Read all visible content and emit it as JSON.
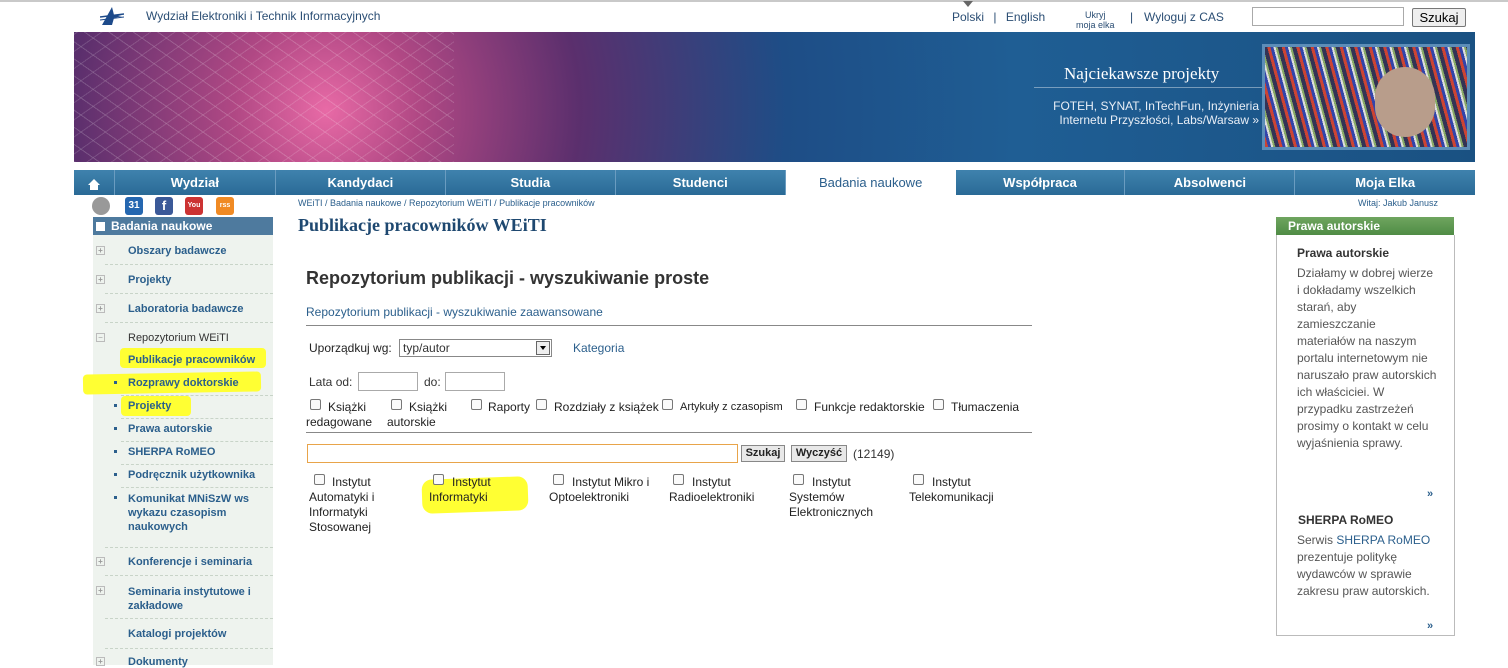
{
  "header": {
    "faculty_name": "Wydział Elektroniki i Technik Informacyjnych",
    "lang_polish": "Polski",
    "lang_sep": "|",
    "lang_english": "English",
    "hide_line1": "Ukryj",
    "hide_line2": "moja elka",
    "logout_sep": "|",
    "logout": "Wyloguj z CAS",
    "search_button": "Szukaj"
  },
  "banner": {
    "title": "Najciekawsze projekty",
    "desc": "FOTEH, SYNAT, InTechFun, Inżynieria Internetu Przyszłości, Labs/Warsaw »"
  },
  "nav": {
    "items": [
      "Wydział",
      "Kandydaci",
      "Studia",
      "Studenci",
      "Badania naukowe",
      "Współpraca",
      "Absolwenci",
      "Moja Elka"
    ]
  },
  "social": {
    "calendar": "31",
    "facebook": "f",
    "youtube": "You",
    "rss": "rss"
  },
  "sidebar": {
    "title": "Badania naukowe",
    "items": [
      "Obszary badawcze",
      "Projekty",
      "Laboratoria badawcze",
      "Repozytorium WEiTI",
      "Konferencje i seminaria",
      "Seminaria instytutowe i zakładowe",
      "Katalogi projektów",
      "Dokumenty"
    ],
    "sub_items": [
      "Publikacje pracowników",
      "Rozprawy doktorskie",
      "Projekty",
      "Prawa autorskie",
      "SHERPA RoMEO",
      "Podręcznik użytkownika",
      "Komunikat MNiSzW ws wykazu czasopism naukowych"
    ]
  },
  "breadcrumb": "WEiTI / Badania naukowe / Repozytorium WEiTI / Publikacje pracowników",
  "welcome": "Witaj: Jakub Janusz",
  "page_title": "Publikacje pracowników WEiTI",
  "search": {
    "title": "Repozytorium publikacji - wyszukiwanie proste",
    "advanced_link": "Repozytorium publikacji - wyszukiwanie zaawansowane",
    "sort_label": "Uporządkuj wg:",
    "sort_value": "typ/autor",
    "category_link": "Kategoria",
    "years_from_label": "Lata od:",
    "years_to_label": "do:",
    "types": [
      "Książki redagowane",
      "Książki autorskie",
      "Raporty",
      "Rozdziały z książek",
      "Artykuły z czasopism",
      "Funkcje redaktorskie",
      "Tłumaczenia"
    ],
    "search_button": "Szukaj",
    "clear_button": "Wyczyść",
    "count": "(12149)",
    "institutes": [
      "Instytut Automatyki i Informatyki Stosowanej",
      "Instytut Informatyki",
      "Instytut Mikro i Optoelektroniki",
      "Instytut Radioelektroniki",
      "Instytut Systemów Elektronicznych",
      "Instytut Telekomunikacji"
    ]
  },
  "right_panel": {
    "header": "Prawa autorskie",
    "section1_title": "Prawa autorskie",
    "section1_text": "Działamy w dobrej wierze i dokładamy wszelkich starań, aby zamieszczanie materiałów na naszym portalu internetowym nie naruszało praw autorskich ich właściciei. W przypadku zastrzeżeń prosimy o kontakt w celu wyjaśnienia sprawy.",
    "more": "»",
    "section2_title": "SHERPA RoMEO",
    "section2_pre": "Serwis",
    "section2_link": "SHERPA RoMEO",
    "section2_text": "prezentuje politykę wydawców w sprawie zakresu praw autorskich."
  },
  "colors": {
    "nav_blue": "#2b6f9b",
    "highlight": "#ffff33",
    "right_header": "#5a9a4e"
  }
}
